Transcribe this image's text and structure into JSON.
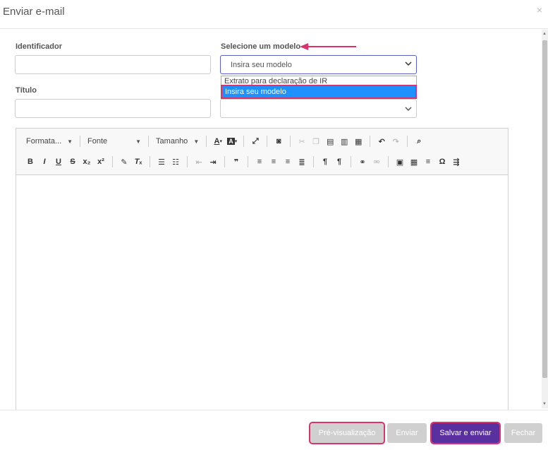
{
  "modal": {
    "title": "Enviar e-mail",
    "close": "×"
  },
  "form": {
    "identifier_label": "Identificador",
    "identifier_value": "",
    "model_label": "Selecione um modelo",
    "model_selected": "Insira seu modelo",
    "title_label": "Título",
    "title_value": "",
    "dropdown_options": [
      "Extrato para declaração de IR",
      "Insira seu modelo"
    ]
  },
  "toolbar": {
    "format_label": "Formata...",
    "font_label": "Fonte",
    "size_label": "Tamanho"
  },
  "footer": {
    "preview_label": "Pré-visualização",
    "send_label": "Enviar",
    "save_send_label": "Salvar e enviar",
    "close_label": "Fechar"
  },
  "colors": {
    "accent": "#5a2fa0",
    "highlight": "#d8336a",
    "selected_option": "#1e90ff"
  }
}
